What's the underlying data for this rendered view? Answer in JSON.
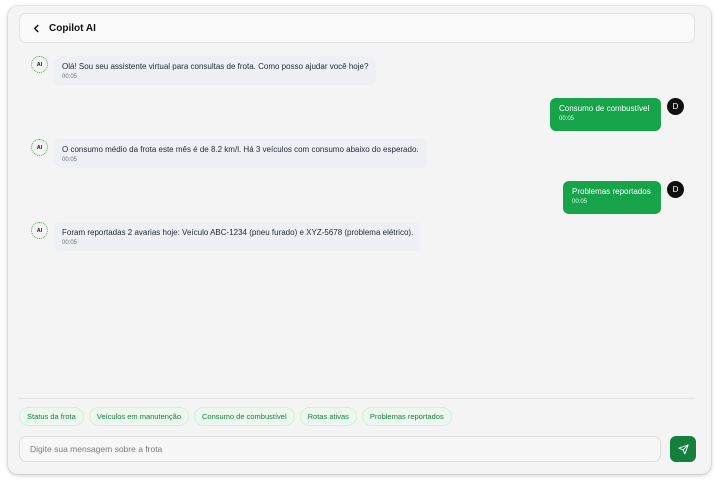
{
  "header": {
    "back_icon": "chevron-left-icon",
    "title": "Copilot AI"
  },
  "ai_avatar_label": "AI",
  "messages": [
    {
      "from": "ai",
      "text": "Olá! Sou seu assistente virtual para consultas de frota. Como posso ajudar você hoje?",
      "time": "00:05"
    },
    {
      "from": "user",
      "text": "Consumo de combustível",
      "time": "00:05",
      "avatar": "D"
    },
    {
      "from": "ai",
      "text": "O consumo médio da frota este mês é de 8.2 km/l. Há 3 veículos com consumo abaixo do esperado.",
      "time": "00:05"
    },
    {
      "from": "user",
      "text": "Problemas reportados",
      "time": "00:05",
      "avatar": "D"
    },
    {
      "from": "ai",
      "text": "Foram reportadas 2 avarias hoje: Veículo ABC-1234 (pneu furado) e XYZ-5678 (problema elétrico).",
      "time": "00:05"
    }
  ],
  "suggestions": [
    "Status da frota",
    "Veículos em manutenção",
    "Consumo de combustível",
    "Rotas ativas",
    "Problemas reportados"
  ],
  "input": {
    "placeholder": "Digite sua mensagem sobre a frota",
    "value": ""
  },
  "send_icon": "send-icon",
  "colors": {
    "accent": "#16a34a",
    "accent_dark": "#15803d",
    "chip_bg": "#ecf8ef"
  }
}
